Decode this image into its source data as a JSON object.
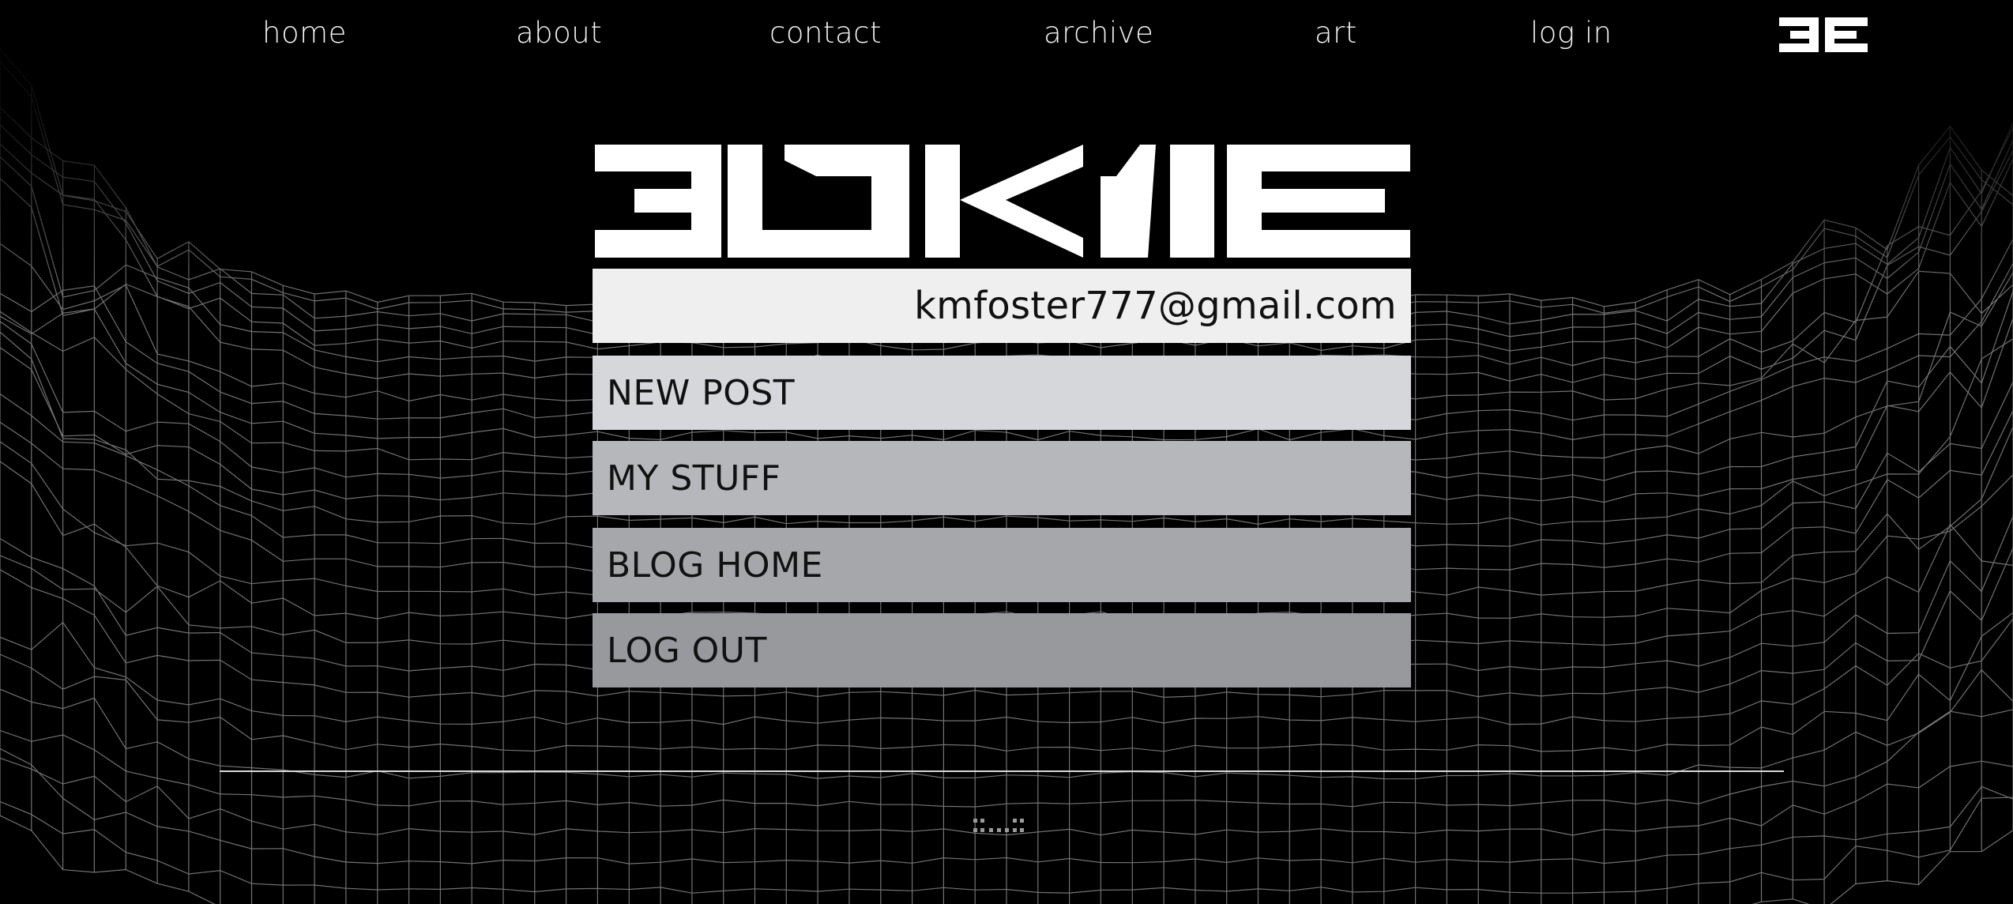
{
  "nav": {
    "items": [
      {
        "label": "home"
      },
      {
        "label": "about"
      },
      {
        "label": "contact"
      },
      {
        "label": "archive"
      },
      {
        "label": "art"
      },
      {
        "label": "log in"
      }
    ],
    "logo_icon": "ee-monogram-logo-icon"
  },
  "main": {
    "wordmark_icon": "site-wordmark-logo",
    "user_email": "kmfoster777@gmail.com",
    "menu": [
      {
        "label": "NEW POST"
      },
      {
        "label": "MY STUFF"
      },
      {
        "label": "BLOG HOME"
      },
      {
        "label": "LOG OUT"
      }
    ]
  },
  "colors": {
    "background": "#000000",
    "nav_text": "#f2f2f2",
    "email_bar": "#efefef",
    "menu_1": "#d6d7db",
    "menu_2": "#b6b7bb",
    "menu_3": "#a6a7ab",
    "menu_4": "#98999d"
  },
  "footer": {
    "mark_icon": "footer-pixel-mark-icon"
  }
}
